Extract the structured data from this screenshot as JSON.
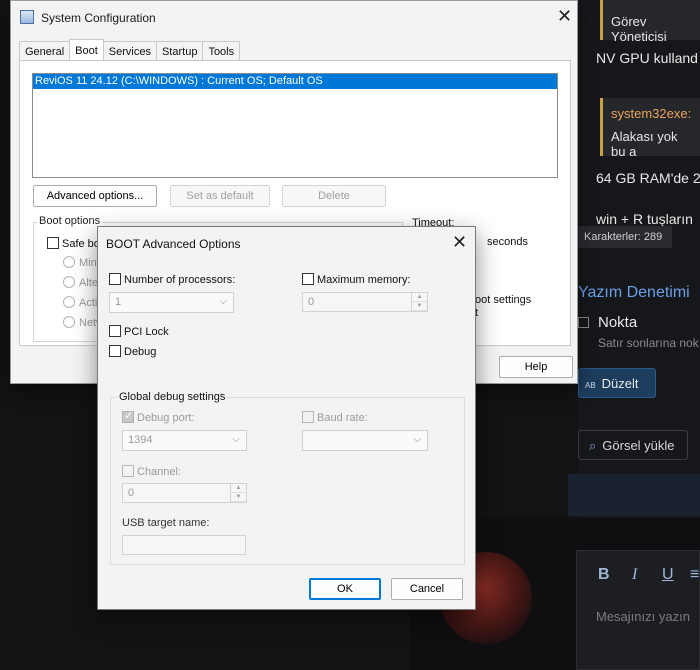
{
  "background": {
    "quote1_text": "Görev Yöneticisi",
    "line1": "NV GPU kulland",
    "quote2_author": "system32exe:",
    "quote2_text": "Alakası yok bu a",
    "line2": "64 GB RAM'de 2",
    "line3": "win + R tuşların",
    "char_count": "Karakterler: 289",
    "section_title": "Yazım Denetimi",
    "option_label": "Nokta",
    "option_desc": "Satır sonlarına nok",
    "fix_button": "Düzelt",
    "fix_badge": "AB",
    "upload_button": "Görsel yükle",
    "editor_bold": "B",
    "editor_italic": "I",
    "editor_underline": "U",
    "editor_more": "≡",
    "editor_placeholder": "Mesajınızı yazın"
  },
  "sysconfig": {
    "title": "System Configuration",
    "close": "✕",
    "tabs": [
      "General",
      "Boot",
      "Services",
      "Startup",
      "Tools"
    ],
    "os_entry": "ReviOS 11 24.12 (C:\\WINDOWS) : Current OS; Default OS",
    "advanced_button": "Advanced options...",
    "set_default_button": "Set as default",
    "delete_button": "Delete",
    "boot_options_label": "Boot options",
    "safe_boot": "Safe bo",
    "radios": [
      "Minir",
      "Altei",
      "Activ",
      "Netw"
    ],
    "timeout_label": "Timeout:",
    "seconds_label": "seconds",
    "boot_settings": "oot settings",
    "boot_settings2": "t",
    "help_button": "Help"
  },
  "dialog": {
    "title": "BOOT Advanced Options",
    "close": "✕",
    "num_processors_label": "Number of processors:",
    "num_processors_value": "1",
    "max_memory_label": "Maximum memory:",
    "max_memory_value": "0",
    "pci_lock": "PCI Lock",
    "debug": "Debug",
    "global_debug_label": "Global debug settings",
    "debug_port_label": "Debug port:",
    "debug_port_value": "1394",
    "baud_rate_label": "Baud rate:",
    "channel_label": "Channel:",
    "channel_value": "0",
    "usb_target_label": "USB target name:",
    "ok_button": "OK",
    "cancel_button": "Cancel"
  }
}
